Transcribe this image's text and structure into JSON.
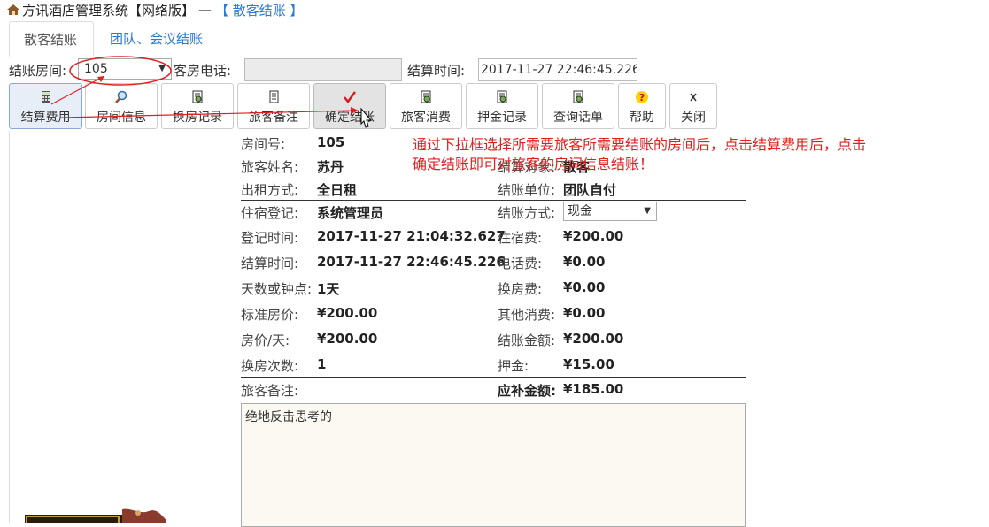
{
  "titlebar": {
    "app": "方讯酒店管理系统【网络版】",
    "separator": "—",
    "current": "【 散客结账 】"
  },
  "tabs": [
    {
      "label": "散客结账"
    },
    {
      "label": "团队、会议结账"
    }
  ],
  "form": {
    "room_label": "结账房间:",
    "room_value": "105",
    "phone_label": "客房电话:",
    "phone_value": "",
    "time_label": "结算时间:",
    "time_value": "2017-11-27 22:46:45.226"
  },
  "toolbar": [
    {
      "label": "结算费用",
      "icon": "calculator-icon"
    },
    {
      "label": "房间信息",
      "icon": "magnifier-icon"
    },
    {
      "label": "换房记录",
      "icon": "document-icon"
    },
    {
      "label": "旅客备注",
      "icon": "note-icon"
    },
    {
      "label": "确定结账",
      "icon": "check-icon"
    },
    {
      "label": "旅客消费",
      "icon": "document-icon"
    },
    {
      "label": "押金记录",
      "icon": "document-icon"
    },
    {
      "label": "查询话单",
      "icon": "document-icon"
    },
    {
      "label": "帮助",
      "icon": "help-icon"
    },
    {
      "label": "关闭",
      "icon": "close-icon"
    }
  ],
  "details": {
    "room_no_label": "房间号:",
    "room_no": "105",
    "guest_label": "旅客姓名:",
    "guest": "苏丹",
    "settle_obj_label": "结算对象:",
    "settle_obj": "散客",
    "rent_label": "出租方式:",
    "rent": "全日租",
    "unit_label": "结账单位:",
    "unit": "团队自付",
    "reg_label": "住宿登记:",
    "reg": "系统管理员",
    "method_label": "结账方式:",
    "method": "现金",
    "checkin_label": "登记时间:",
    "checkin": "2017-11-27 21:04:32.627",
    "lodging_label": "住宿费:",
    "lodging": "¥200.00",
    "settle_time_label": "结算时间:",
    "settle_time": "2017-11-27 22:46:45.226",
    "phone_fee_label": "电话费:",
    "phone_fee": "¥0.00",
    "days_label": "天数或钟点:",
    "days": "1天",
    "change_fee_label": "换房费:",
    "change_fee": "¥0.00",
    "std_price_label": "标准房价:",
    "std_price": "¥200.00",
    "other_label": "其他消费:",
    "other": "¥0.00",
    "daily_label": "房价/天:",
    "daily": "¥200.00",
    "amount_label": "结账金额:",
    "amount": "¥200.00",
    "changes_label": "换房次数:",
    "changes": "1",
    "deposit_label": "押金:",
    "deposit": "¥15.00",
    "remark_label": "旅客备注:",
    "due_label": "应补金额:",
    "due": "¥185.00",
    "remark_text": "绝地反击思考的"
  },
  "annotation": {
    "line1": "通过下拉框选择所需要旅客所需要结账的房间后，点击结算费用后，点击",
    "line2": "确定结账即可对旅客的房间信息结账！"
  },
  "colors": {
    "accent": "#2a7ad2",
    "annotation": "#e02020"
  }
}
